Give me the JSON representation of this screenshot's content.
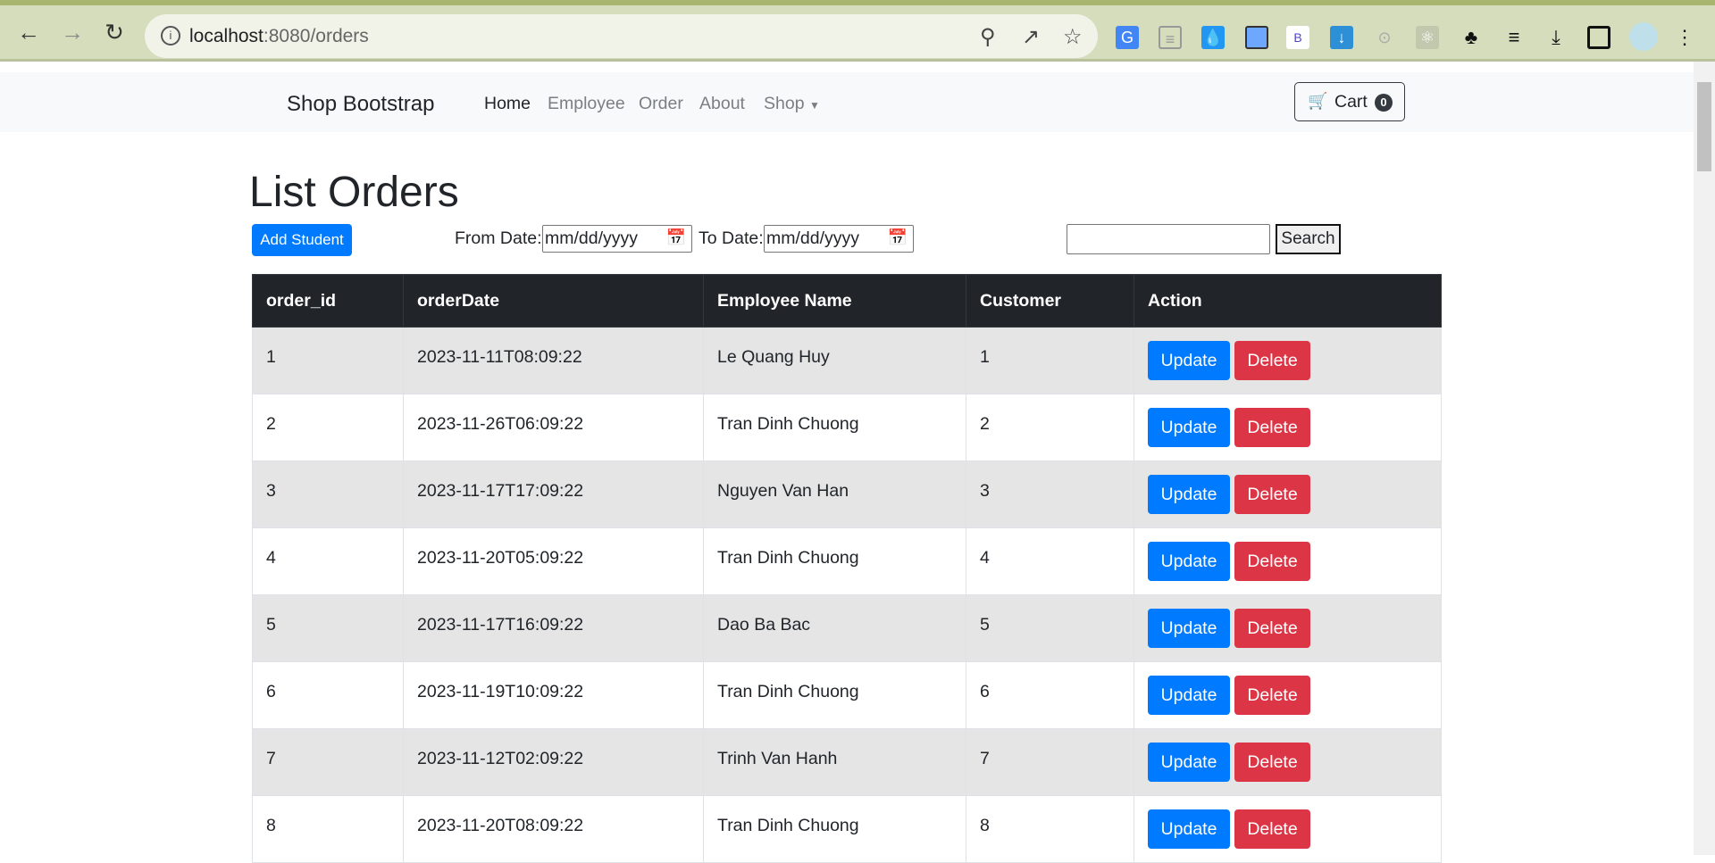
{
  "browser": {
    "url_host": "localhost",
    "url_rest": ":8080/orders",
    "extensions": [
      "google-translate-icon",
      "reader-icon",
      "droplet-icon",
      "phone-icon",
      "bootstrap-icon",
      "download-arrow-icon",
      "orbit-icon",
      "react-icon",
      "puzzle-icon",
      "media-queue-icon",
      "downloads-icon",
      "side-panel-icon",
      "profile-avatar",
      "menu-dots-icon"
    ]
  },
  "navbar": {
    "brand": "Shop Bootstrap",
    "links": [
      "Home",
      "Employee",
      "Order",
      "About",
      "Shop"
    ],
    "cart_label": "Cart",
    "cart_count": "0"
  },
  "page": {
    "title": "List Orders",
    "add_button": "Add Student",
    "from_label": "From Date:",
    "to_label": "To Date:",
    "date_placeholder": "mm/dd/yyyy",
    "search_value": "",
    "search_button": "Search"
  },
  "table": {
    "headers": [
      "order_id",
      "orderDate",
      "Employee Name",
      "Customer",
      "Action"
    ],
    "update_label": "Update",
    "delete_label": "Delete",
    "rows": [
      [
        "1",
        "2023-11-11T08:09:22",
        "Le Quang Huy",
        "1"
      ],
      [
        "2",
        "2023-11-26T06:09:22",
        "Tran Dinh Chuong",
        "2"
      ],
      [
        "3",
        "2023-11-17T17:09:22",
        "Nguyen Van Han",
        "3"
      ],
      [
        "4",
        "2023-11-20T05:09:22",
        "Tran Dinh Chuong",
        "4"
      ],
      [
        "5",
        "2023-11-17T16:09:22",
        "Dao Ba Bac",
        "5"
      ],
      [
        "6",
        "2023-11-19T10:09:22",
        "Tran Dinh Chuong",
        "6"
      ],
      [
        "7",
        "2023-11-12T02:09:22",
        "Trinh Van Hanh",
        "7"
      ],
      [
        "8",
        "2023-11-20T08:09:22",
        "Tran Dinh Chuong",
        "8"
      ]
    ]
  }
}
